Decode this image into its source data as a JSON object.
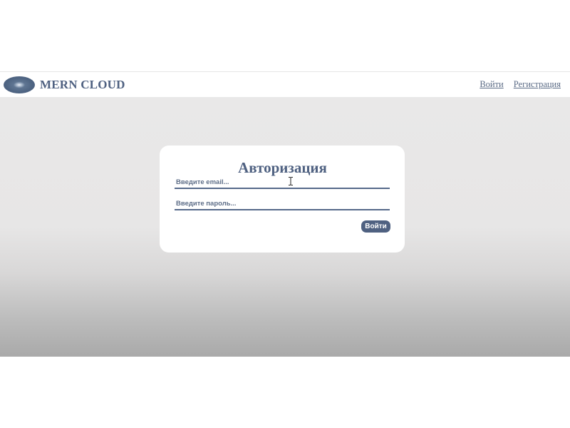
{
  "navbar": {
    "brand_title": "MERN CLOUD",
    "logo_icon": "cloud-disc-logo",
    "links": {
      "login": "Войти",
      "register": "Регистрация"
    }
  },
  "login_form": {
    "title": "Авторизация",
    "email_placeholder": "Введите email...",
    "email_value": "",
    "password_placeholder": "Введите пароль...",
    "password_value": "",
    "submit_label": "Войти"
  },
  "colors": {
    "brand": "#4f6181",
    "card_background": "#ffffff",
    "page_background": "#e7e6e6"
  }
}
